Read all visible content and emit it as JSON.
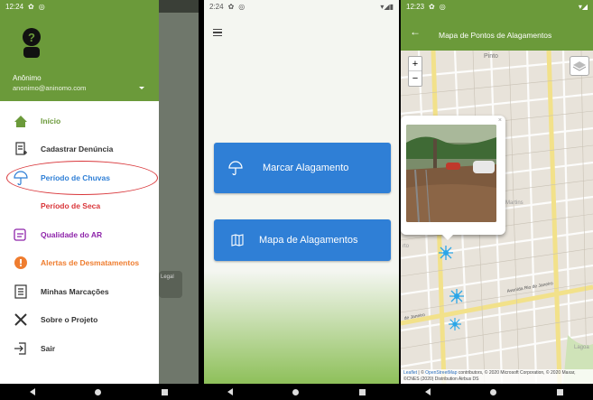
{
  "screen1": {
    "status_time": "12:24",
    "user_name": "Anônimo",
    "user_email": "anonimo@aninomo.com",
    "menu": [
      {
        "label": "Início",
        "icon": "home-icon",
        "color": "#6b9a3a"
      },
      {
        "label": "Cadastrar Denúncia",
        "icon": "document-add-icon",
        "color": "#333333"
      },
      {
        "label": "Período de Chuvas",
        "icon": "umbrella-icon",
        "color": "#2f7fd6"
      },
      {
        "label": "Período de Seca",
        "icon": "fire-icon",
        "color": "#d9363a"
      },
      {
        "label": "Qualidade do AR",
        "icon": "air-quality-icon",
        "color": "#8e24aa"
      },
      {
        "label": "Alertas de Desmatamentos",
        "icon": "alert-icon",
        "color": "#ef7d2f"
      },
      {
        "label": "Minhas Marcações",
        "icon": "list-icon",
        "color": "#333333"
      },
      {
        "label": "Sobre o Projeto",
        "icon": "tools-icon",
        "color": "#333333"
      },
      {
        "label": "Sair",
        "icon": "exit-icon",
        "color": "#333333"
      }
    ],
    "legal_text": "Legal"
  },
  "screen2": {
    "status_time": "2:24",
    "btn_marcar": "Marcar Alagamento",
    "btn_mapa": "Mapa de Alagamentos"
  },
  "screen3": {
    "status_time": "12:23",
    "title": "Mapa de Pontos de Alagamentos",
    "zoom_in": "+",
    "zoom_out": "−",
    "attrib_leaflet": "Leaflet",
    "attrib_sep": " | © ",
    "attrib_osm": "OpenStreetMap",
    "attrib_rest": " contributors, © 2020 Microsoft Corporation, © 2020 Maxar, ©CNES (2020) Distribution Airbus DS",
    "street_labels": [
      "Pinto",
      "Avenida Rio de Janeiro",
      "de Janeiro",
      "Martins",
      "rto",
      "Lagoa"
    ]
  }
}
